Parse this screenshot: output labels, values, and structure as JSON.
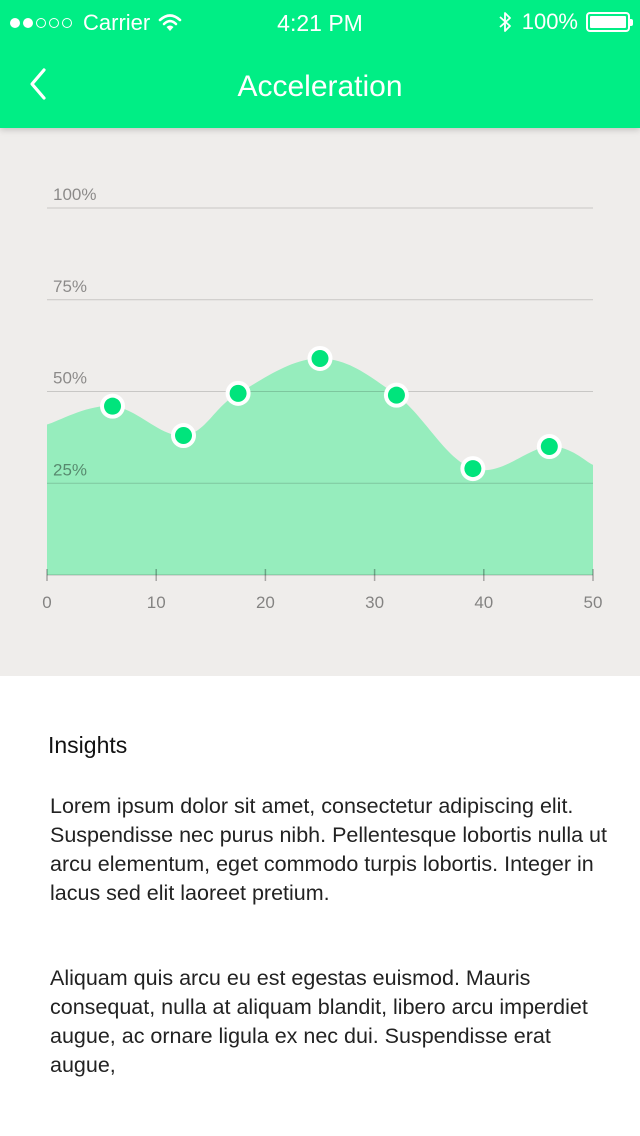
{
  "status_bar": {
    "carrier": "Carrier",
    "time": "4:21 PM",
    "battery_text": "100%",
    "signal_bars_filled": 2,
    "signal_bars_total": 5
  },
  "nav": {
    "title": "Acceleration",
    "back_icon": "chevron-left-icon"
  },
  "chart_data": {
    "type": "area",
    "x": [
      6,
      12.5,
      17.5,
      25,
      32,
      39,
      46
    ],
    "series": [
      {
        "values": [
          46,
          38,
          49.5,
          59,
          49,
          29,
          35
        ]
      }
    ],
    "xlim": [
      0,
      50
    ],
    "ylim": [
      0,
      100
    ],
    "xticks": [
      "0",
      "10",
      "20",
      "30",
      "40",
      "50"
    ],
    "yticks": [
      "25%",
      "50%",
      "75%",
      "100%"
    ],
    "grid": true,
    "colors": {
      "fill": "#96edbd",
      "point": "#00e47c",
      "point_ring": "#ffffff"
    }
  },
  "insights": {
    "heading": "Insights",
    "paragraphs": [
      "Lorem ipsum dolor sit amet, consectetur adipiscing elit. Suspendisse nec purus nibh. Pellentesque lobortis nulla ut arcu elementum, eget commodo turpis lobortis. Integer in lacus sed elit laoreet pretium.",
      "Aliquam quis arcu eu est egestas euismod. Mauris consequat, nulla at aliquam blandit, libero arcu imperdiet augue, ac ornare ligula ex nec dui. Suspendisse erat augue,"
    ]
  },
  "colors": {
    "accent": "#00ee85",
    "chart_background": "#efedeb"
  }
}
